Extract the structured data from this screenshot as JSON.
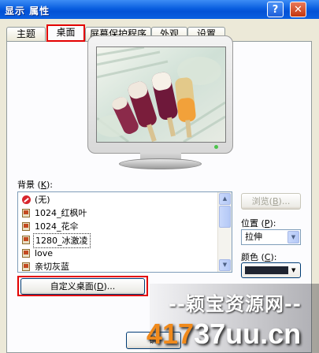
{
  "window": {
    "title": "显示 属性",
    "help_glyph": "?",
    "close_glyph": "✕"
  },
  "tabs": [
    {
      "label": "主题",
      "active": false
    },
    {
      "label": "桌面",
      "active": true
    },
    {
      "label": "屏幕保护程序",
      "active": false
    },
    {
      "label": "外观",
      "active": false
    },
    {
      "label": "设置",
      "active": false
    }
  ],
  "preview": {
    "image_subject": "ice-pops-wallpaper"
  },
  "background": {
    "label_text": "背景 (",
    "label_key": "K",
    "label_tail": "):",
    "items": [
      {
        "label": "(无)",
        "icon": "none-icon",
        "selected": false
      },
      {
        "label": "1024_红枫叶",
        "icon": "bitmap-icon",
        "selected": false
      },
      {
        "label": "1024_花伞",
        "icon": "bitmap-icon",
        "selected": false
      },
      {
        "label": "1280_冰激凌",
        "icon": "bitmap-icon",
        "selected": true
      },
      {
        "label": "love",
        "icon": "bitmap-icon",
        "selected": false
      },
      {
        "label": "亲切灰蓝",
        "icon": "bitmap-icon",
        "selected": false
      }
    ]
  },
  "browse_button": {
    "label_text": "浏览(",
    "label_key": "B",
    "label_tail": ")..."
  },
  "position": {
    "label_text": "位置 (",
    "label_key": "P",
    "label_tail": "):",
    "value": "拉伸"
  },
  "color": {
    "label_text": "颜色 (",
    "label_key": "C",
    "label_tail": "):",
    "value_hex": "#1f2430"
  },
  "customize_button": {
    "label_text": "自定义桌面(",
    "label_key": "D",
    "label_tail": ")..."
  },
  "ok_button": {
    "label": "确"
  },
  "watermark": {
    "line1": "--颖宝资源网--",
    "line2_a": "417",
    "line2_b": "37uu.cn"
  }
}
